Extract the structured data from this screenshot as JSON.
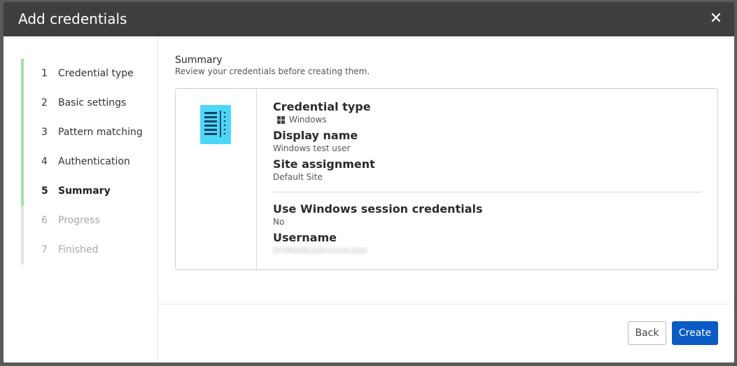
{
  "dialog": {
    "title": "Add credentials",
    "close_icon": "close-icon"
  },
  "steps": [
    {
      "num": "1",
      "label": "Credential type"
    },
    {
      "num": "2",
      "label": "Basic settings"
    },
    {
      "num": "3",
      "label": "Pattern matching"
    },
    {
      "num": "4",
      "label": "Authentication"
    },
    {
      "num": "5",
      "label": "Summary"
    },
    {
      "num": "6",
      "label": "Progress"
    },
    {
      "num": "7",
      "label": "Finished"
    }
  ],
  "summary": {
    "title": "Summary",
    "subtitle": "Review your credentials before creating them.",
    "icon": "document-list-icon",
    "icon_color": "#4dd7f7",
    "fields": {
      "credential_type_label": "Credential type",
      "credential_type_value": "Windows",
      "display_name_label": "Display name",
      "display_name_value": "Windows test user",
      "site_assignment_label": "Site assignment",
      "site_assignment_value": "Default Site",
      "session_creds_label": "Use Windows session credentials",
      "session_creds_value": "No",
      "username_label": "Username",
      "username_value": "DOMAIN\\Administrator"
    }
  },
  "footer": {
    "back_label": "Back",
    "create_label": "Create"
  },
  "colors": {
    "accent": "#0a5bc4",
    "step_complete": "#a6dea7",
    "titlebar": "#3e3e3e"
  }
}
